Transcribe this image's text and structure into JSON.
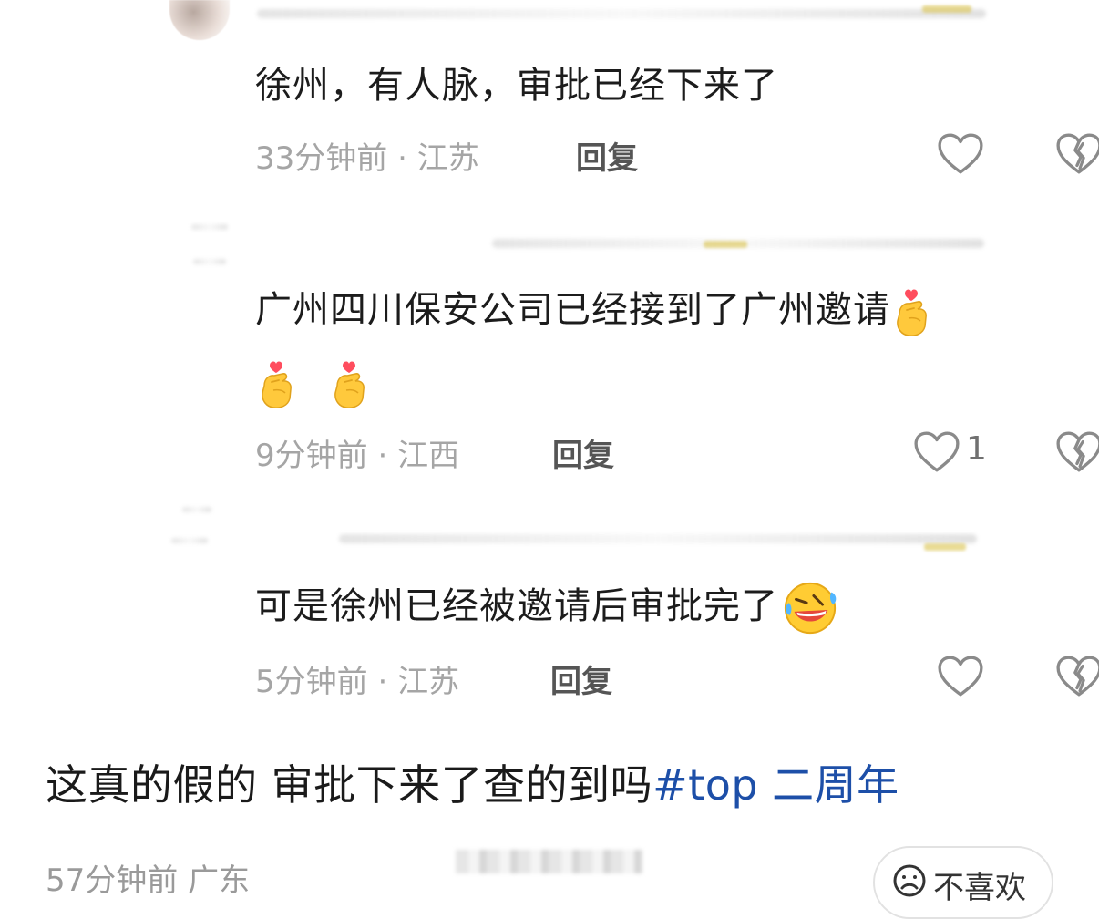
{
  "comments": [
    {
      "text": "徐州，有人脉，审批已经下来了",
      "time": "33分钟前",
      "location": "江苏",
      "reply_label": "回复",
      "like_count": "",
      "icons": [
        "heart-outline-icon",
        "broken-heart-icon"
      ]
    },
    {
      "text": "广州四川保安公司已经接到了广州邀请",
      "emojis": [
        "finger-heart-emoji",
        "finger-heart-emoji",
        "finger-heart-emoji"
      ],
      "time": "9分钟前",
      "location": "江西",
      "reply_label": "回复",
      "like_count": "1",
      "icons": [
        "heart-outline-icon",
        "broken-heart-icon"
      ]
    },
    {
      "text": "可是徐州已经被邀请后审批完了",
      "emojis": [
        "rolling-laughing-emoji"
      ],
      "time": "5分钟前",
      "location": "江苏",
      "reply_label": "回复",
      "like_count": "",
      "icons": [
        "heart-outline-icon",
        "broken-heart-icon"
      ]
    }
  ],
  "post": {
    "text": "这真的假的 审批下来了查的到吗",
    "hashtag": "#top 二周年",
    "time": "57分钟前",
    "location": "广东",
    "dislike_label": "不喜欢"
  },
  "colors": {
    "hashtag": "#1d4fa8",
    "meta_text": "#a5a5a5",
    "icon_stroke": "#8a8a8a"
  }
}
